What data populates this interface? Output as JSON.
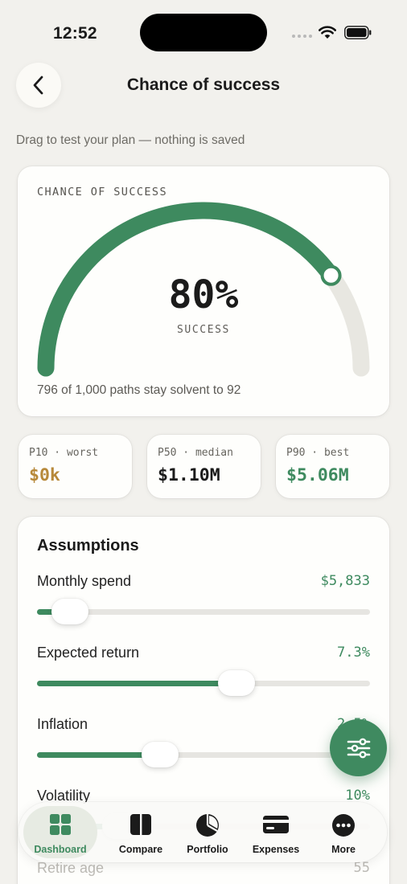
{
  "status_bar": {
    "time": "12:52"
  },
  "header": {
    "title": "Chance of success"
  },
  "subtitle": "Drag to test your plan — nothing is saved",
  "gauge": {
    "kicker": "CHANCE OF SUCCESS",
    "percent_label": "80%",
    "percent_value": 0.8,
    "success_label": "SUCCESS",
    "footnote": "796 of 1,000 paths stay solvent to 92",
    "accent": "#3e8a5f",
    "track_color": "#e8e7e1"
  },
  "percentiles": [
    {
      "label": "P10 · worst",
      "value": "$0k",
      "color": "#b7893a"
    },
    {
      "label": "P50 · median",
      "value": "$1.10M",
      "color": "#1b1b1b"
    },
    {
      "label": "P90 · best",
      "value": "$5.06M",
      "color": "#3e8a5f"
    }
  ],
  "assumptions": {
    "title": "Assumptions",
    "rows": [
      {
        "label": "Monthly spend",
        "value": "$5,833",
        "level": 0.1
      },
      {
        "label": "Expected return",
        "value": "7.3%",
        "level": 0.6
      },
      {
        "label": "Inflation",
        "value": "2.5%",
        "level": 0.37
      },
      {
        "label": "Volatility",
        "value": "10%",
        "level": 0.25
      },
      {
        "label": "Retire age",
        "value": "55",
        "level": 0.5
      }
    ]
  },
  "fab": {
    "icon": "sliders-icon"
  },
  "tabbar": {
    "items": [
      {
        "label": "Dashboard",
        "icon": "grid-icon",
        "active": true
      },
      {
        "label": "Compare",
        "icon": "columns-icon",
        "active": false
      },
      {
        "label": "Portfolio",
        "icon": "pie-chart-icon",
        "active": false
      },
      {
        "label": "Expenses",
        "icon": "card-icon",
        "active": false
      },
      {
        "label": "More",
        "icon": "more-icon",
        "active": false
      }
    ]
  },
  "colors": {
    "accent": "#3e8a5f",
    "background": "#f2f1ed",
    "warning": "#b7893a"
  }
}
